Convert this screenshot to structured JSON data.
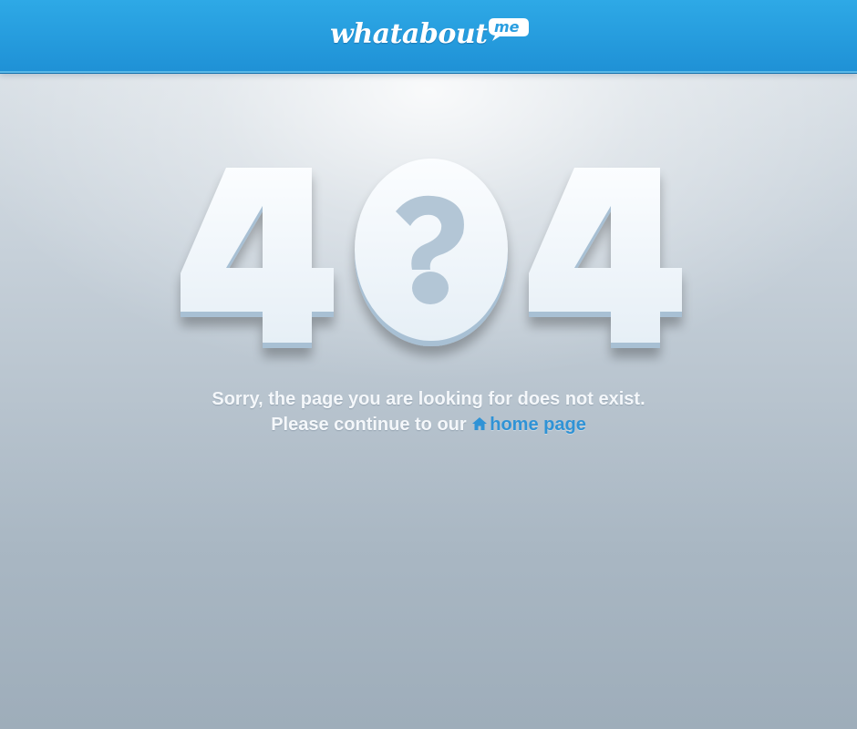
{
  "header": {
    "logo_text": "whatabout",
    "logo_badge": "me",
    "brand_color": "#2ea9e6"
  },
  "error": {
    "code_left": "4",
    "code_middle": "0",
    "code_right": "4",
    "message_line1": "Sorry, the page you are looking for does not exist.",
    "message_line2_prefix": "Please continue to our",
    "home_link_label": "home page",
    "home_icon": "home-icon",
    "link_color": "#2f93d6"
  }
}
